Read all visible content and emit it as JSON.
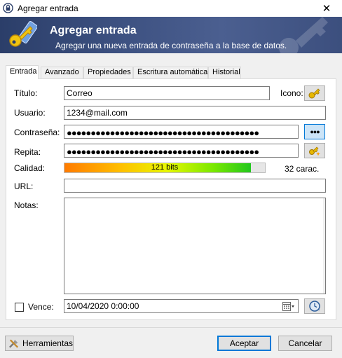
{
  "window": {
    "title": "Agregar entrada",
    "close_symbol": "✕"
  },
  "banner": {
    "title": "Agregar entrada",
    "subtitle": "Agregar una nueva entrada de contraseña a la base de datos."
  },
  "tabs": [
    {
      "label": "Entrada",
      "active": true
    },
    {
      "label": "Avanzado",
      "active": false
    },
    {
      "label": "Propiedades",
      "active": false
    },
    {
      "label": "Escritura automática",
      "active": false
    },
    {
      "label": "Historial",
      "active": false
    }
  ],
  "form": {
    "title_label": "Título:",
    "title_value": "Correo",
    "icon_label": "Icono:",
    "user_label": "Usuario:",
    "user_value": "1234@mail.com",
    "password_label": "Contraseña:",
    "password_value": "●●●●●●●●●●●●●●●●●●●●●●●●●●●●●●●●●●●●●●●●",
    "reveal_label": "●●●",
    "repeat_label": "Repita:",
    "repeat_value": "●●●●●●●●●●●●●●●●●●●●●●●●●●●●●●●●●●●●●●●●",
    "quality_label": "Calidad:",
    "quality_text": "121 bits",
    "quality_fraction": 0.93,
    "chars_text": "32 carac.",
    "url_label": "URL:",
    "url_value": "",
    "notes_label": "Notas:",
    "notes_value": "",
    "expires_label": "Vence:",
    "expires_checked": false,
    "expires_value": "10/04/2020  0:00:00"
  },
  "footer": {
    "tools_label": "Herramientas",
    "ok_label": "Aceptar",
    "cancel_label": "Cancelar"
  },
  "colors": {
    "banner": "#3d5181",
    "accent": "#0078d7",
    "key": "#e8b800"
  },
  "icons": [
    "keepass-lock-icon",
    "key-icon",
    "password-generator-icon",
    "calendar-icon",
    "refresh-clock-icon",
    "tools-icon",
    "close-icon"
  ]
}
